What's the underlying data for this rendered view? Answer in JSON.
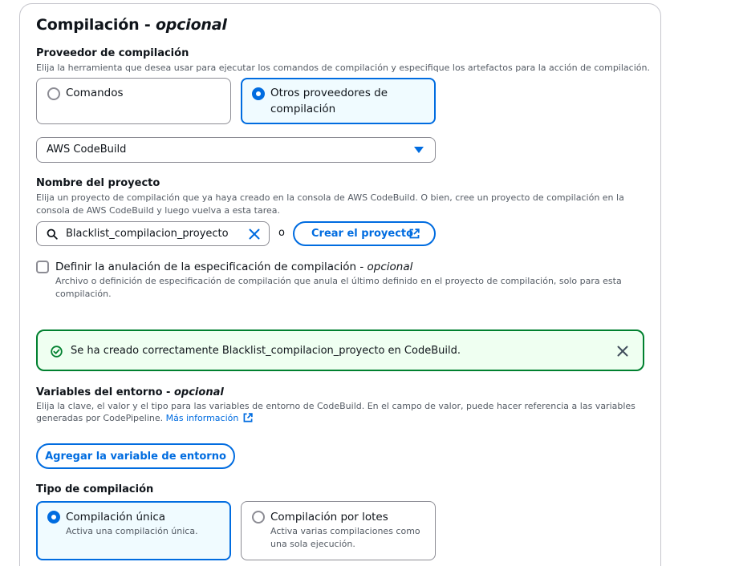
{
  "section": {
    "title": "Compilación",
    "title_optional": "opcional"
  },
  "provider": {
    "label": "Proveedor de compilación",
    "description": "Elija la herramienta que desea usar para ejecutar los comandos de compilación y especifique los artefactos para la acción de compilación.",
    "options": [
      {
        "label": "Comandos",
        "selected": false
      },
      {
        "label_line1": "Otros proveedores de",
        "label_line2": "compilación",
        "selected": true
      }
    ],
    "select_value": "AWS CodeBuild"
  },
  "project": {
    "label": "Nombre del proyecto",
    "description_line1": "Elija un proyecto de compilación que ya haya creado en la consola de AWS CodeBuild. O bien, cree un proyecto de compilación en la",
    "description_line2": "consola de AWS CodeBuild y luego vuelva a esta tarea.",
    "search_value": "Blacklist_compilacion_proyecto",
    "or_text": "o",
    "create_button": "Crear el proyecto"
  },
  "buildspec_override": {
    "label": "Definir la anulación de la especificación de compilación",
    "label_optional": "opcional",
    "checked": false,
    "description_line1": "Archivo o definición de especificación de compilación que anula el último definido en el proyecto de compilación, solo para esta",
    "description_line2": "compilación."
  },
  "alert": {
    "type": "success",
    "message": "Se ha creado correctamente Blacklist_compilacion_proyecto en CodeBuild."
  },
  "env_vars": {
    "label": "Variables del entorno",
    "label_optional": "opcional",
    "description_line1": "Elija la clave, el valor y el tipo para las variables de entorno de CodeBuild. En el campo de valor, puede hacer referencia a las variables",
    "description_line2": "generadas por CodePipeline.",
    "learn_more": "Más información",
    "add_button": "Agregar la variable de entorno"
  },
  "build_type": {
    "label": "Tipo de compilación",
    "options": [
      {
        "label": "Compilación única",
        "sub": "Activa una compilación única.",
        "selected": true
      },
      {
        "label": "Compilación por lotes",
        "sub_line1": "Activa varias compilaciones como",
        "sub_line2": "una sola ejecución.",
        "selected": false
      }
    ]
  },
  "colors": {
    "accent": "#006ce0",
    "success": "#00802f",
    "border": "#8c8c94"
  }
}
